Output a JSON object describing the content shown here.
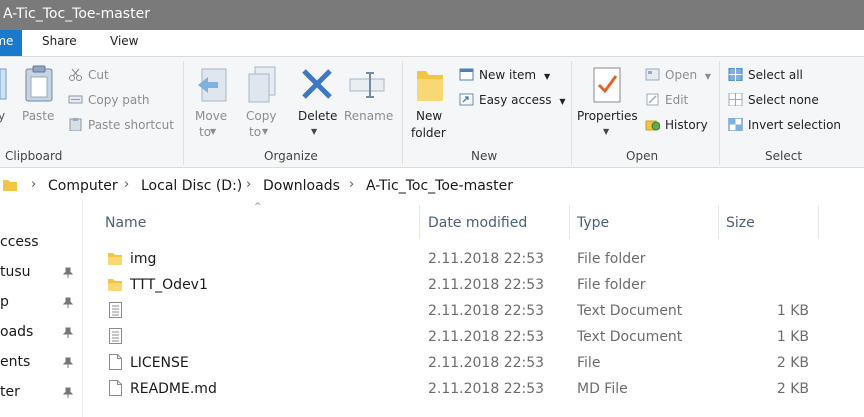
{
  "window": {
    "title": "A-Tic_Toc_Toe-master"
  },
  "tabs": {
    "home": "Home",
    "share": "Share",
    "view": "View"
  },
  "clipboard": {
    "paste": "Paste",
    "cut": "Cut",
    "copy_path": "Copy path",
    "paste_shortcut": "Paste shortcut",
    "label": "Clipboard"
  },
  "organize": {
    "move_to_line1": "Move",
    "move_to_line2": "to",
    "copy_to_line1": "Copy",
    "copy_to_line2": "to",
    "delete": "Delete",
    "rename": "Rename",
    "label": "Organize"
  },
  "new": {
    "new_folder_line1": "New",
    "new_folder_line2": "folder",
    "new_item": "New item",
    "easy_access": "Easy access",
    "label": "New"
  },
  "open": {
    "properties": "Properties",
    "open": "Open",
    "edit": "Edit",
    "history": "History",
    "label": "Open"
  },
  "select": {
    "select_all": "Select all",
    "select_none": "Select none",
    "invert_selection": "Invert selection",
    "label": "Select"
  },
  "address": {
    "crumbs": [
      "Computer",
      "Local Disc (D:)",
      "Downloads",
      "A-Tic_Toc_Toe-master"
    ]
  },
  "nav": {
    "items": [
      {
        "label": "ccess",
        "pinned": false
      },
      {
        "label": "tusu",
        "pinned": true
      },
      {
        "label": "p",
        "pinned": true
      },
      {
        "label": "oads",
        "pinned": true
      },
      {
        "label": "ents",
        "pinned": true
      },
      {
        "label": "ter",
        "pinned": true
      }
    ]
  },
  "columns": {
    "name": "Name",
    "date": "Date modified",
    "type": "Type",
    "size": "Size"
  },
  "files": [
    {
      "name": "img",
      "icon": "folder-icon",
      "date": "2.11.2018 22:53",
      "type": "File folder",
      "size": ""
    },
    {
      "name": "TTT_Odev1",
      "icon": "folder-icon",
      "date": "2.11.2018 22:53",
      "type": "File folder",
      "size": ""
    },
    {
      "name": "",
      "icon": "text-file-icon",
      "date": "2.11.2018 22:53",
      "type": "Text Document",
      "size": "1 KB"
    },
    {
      "name": "",
      "icon": "text-file-icon",
      "date": "2.11.2018 22:53",
      "type": "Text Document",
      "size": "1 KB"
    },
    {
      "name": "LICENSE",
      "icon": "file-icon",
      "date": "2.11.2018 22:53",
      "type": "File",
      "size": "2 KB"
    },
    {
      "name": "README.md",
      "icon": "file-icon",
      "date": "2.11.2018 22:53",
      "type": "MD File",
      "size": "2 KB"
    }
  ]
}
